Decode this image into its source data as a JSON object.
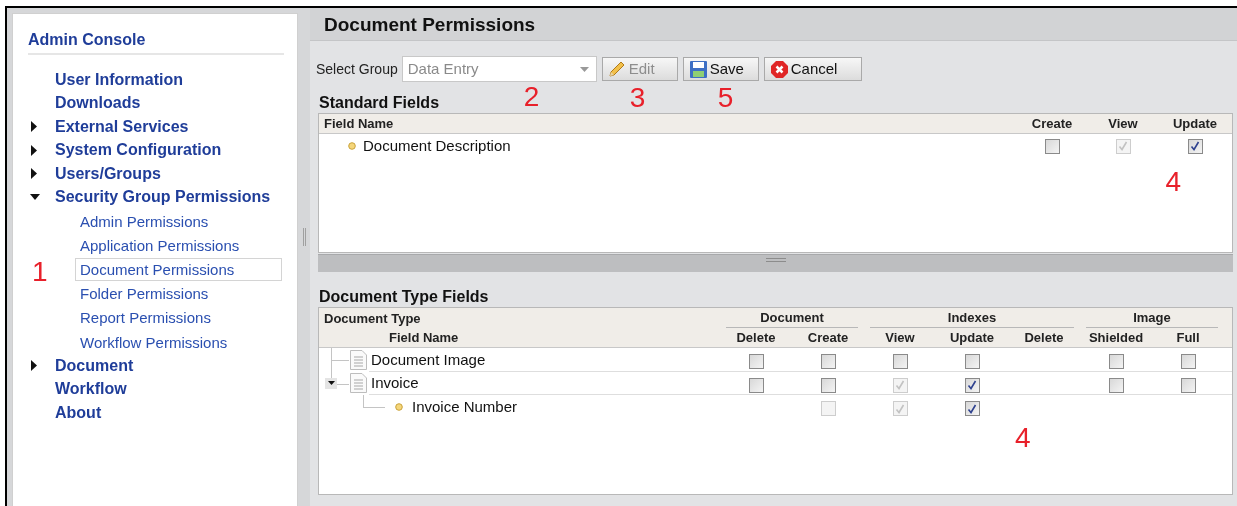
{
  "sidebar": {
    "title": "Admin Console",
    "items": [
      {
        "label": "User Information",
        "selected": false
      },
      {
        "label": "Downloads",
        "selected": false
      },
      {
        "label": "External Services",
        "expanded": false,
        "selected": false
      },
      {
        "label": "System Configuration",
        "expanded": false,
        "selected": false
      },
      {
        "label": "Users/Groups",
        "expanded": false,
        "selected": false
      },
      {
        "label": "Security Group Permissions",
        "expanded": true,
        "selected": false,
        "children": [
          {
            "label": "Admin Permissions",
            "selected": false
          },
          {
            "label": "Application Permissions",
            "selected": false
          },
          {
            "label": "Document Permissions",
            "selected": true,
            "callout": "1"
          },
          {
            "label": "Folder Permissions",
            "selected": false
          },
          {
            "label": "Report Permissions",
            "selected": false
          },
          {
            "label": "Workflow Permissions",
            "selected": false
          }
        ]
      },
      {
        "label": "Document",
        "expanded": false,
        "selected": false
      },
      {
        "label": "Workflow",
        "selected": false
      },
      {
        "label": "About",
        "selected": false
      }
    ]
  },
  "page_title": "Document Permissions",
  "toolbar": {
    "select_label": "Select Group",
    "select": {
      "value": "Data Entry",
      "disabled": true,
      "callout": "2"
    },
    "buttons": [
      {
        "label": "Edit",
        "kind": "edit",
        "disabled": true,
        "callout": "3"
      },
      {
        "label": "Save",
        "kind": "save",
        "disabled": false,
        "callout": "5"
      },
      {
        "label": "Cancel",
        "kind": "cancel",
        "disabled": false
      }
    ]
  },
  "standard_fields": {
    "title": "Standard Fields",
    "columns": [
      "Field Name",
      "Create",
      "View",
      "Update"
    ],
    "callout": "4",
    "rows": [
      {
        "name": "Document Description",
        "cells": [
          {
            "kind": "checkbox",
            "checked": false,
            "disabled": false
          },
          {
            "kind": "checkbox",
            "checked": true,
            "disabled": true
          },
          {
            "kind": "checkbox",
            "checked": true,
            "disabled": false
          }
        ]
      }
    ]
  },
  "document_type_fields": {
    "title": "Document Type Fields",
    "column_groups": [
      "Document",
      "Indexes",
      "Image"
    ],
    "header_left": [
      "Document Type",
      "Field Name"
    ],
    "columns": [
      "Delete",
      "Create",
      "View",
      "Update",
      "Delete",
      "Shielded",
      "Full"
    ],
    "callout": "4",
    "rows": [
      {
        "name": "Document Image",
        "kind": "document",
        "cells": [
          {
            "kind": "checkbox",
            "checked": false,
            "disabled": false
          },
          {
            "kind": "checkbox",
            "checked": false,
            "disabled": false
          },
          {
            "kind": "checkbox",
            "checked": false,
            "disabled": false
          },
          {
            "kind": "checkbox",
            "checked": false,
            "disabled": false
          },
          {
            "kind": "blank"
          },
          {
            "kind": "checkbox",
            "checked": false,
            "disabled": false
          },
          {
            "kind": "checkbox",
            "checked": false,
            "disabled": false
          }
        ]
      },
      {
        "name": "Invoice",
        "kind": "document",
        "expanded": true,
        "cells": [
          {
            "kind": "checkbox",
            "checked": false,
            "disabled": false
          },
          {
            "kind": "checkbox",
            "checked": false,
            "disabled": false
          },
          {
            "kind": "checkbox",
            "checked": true,
            "disabled": true
          },
          {
            "kind": "checkbox",
            "checked": true,
            "disabled": false
          },
          {
            "kind": "blank"
          },
          {
            "kind": "checkbox",
            "checked": false,
            "disabled": false
          },
          {
            "kind": "checkbox",
            "checked": false,
            "disabled": false
          }
        ],
        "children": [
          {
            "name": "Invoice Number",
            "kind": "field",
            "cells": [
              {
                "kind": "blank"
              },
              {
                "kind": "checkbox",
                "checked": false,
                "disabled": true
              },
              {
                "kind": "checkbox",
                "checked": true,
                "disabled": true
              },
              {
                "kind": "checkbox",
                "checked": true,
                "disabled": false
              },
              {
                "kind": "blank"
              },
              {
                "kind": "blank"
              },
              {
                "kind": "blank"
              }
            ]
          }
        ]
      }
    ]
  }
}
